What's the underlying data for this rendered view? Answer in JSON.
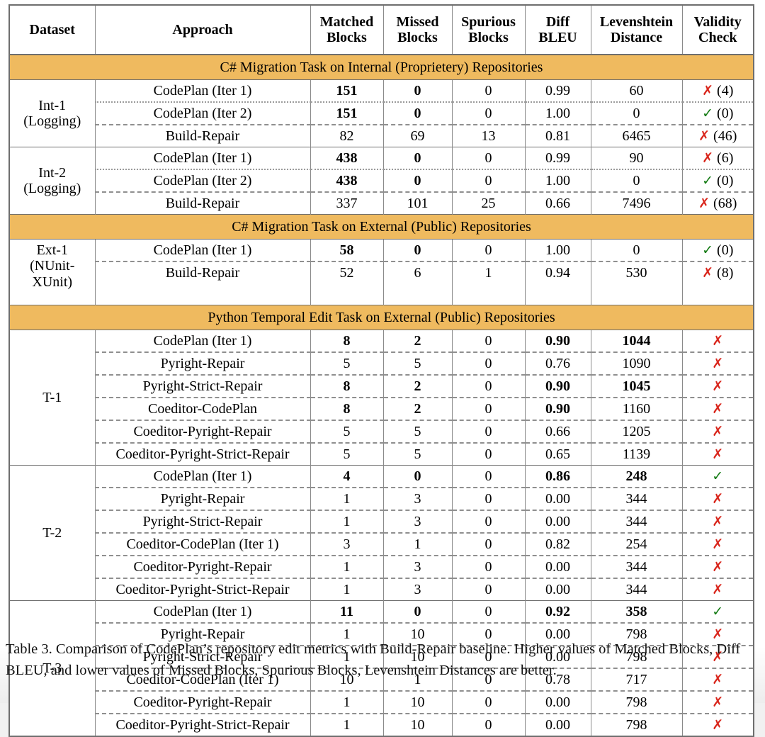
{
  "table": {
    "columns": [
      {
        "id": "dataset",
        "line1": "Dataset",
        "line2": ""
      },
      {
        "id": "approach",
        "line1": "Approach",
        "line2": ""
      },
      {
        "id": "matched",
        "line1": "Matched",
        "line2": "Blocks"
      },
      {
        "id": "missed",
        "line1": "Missed",
        "line2": "Blocks"
      },
      {
        "id": "spurious",
        "line1": "Spurious",
        "line2": "Blocks"
      },
      {
        "id": "bleu",
        "line1": "Diff",
        "line2": "BLEU"
      },
      {
        "id": "lev",
        "line1": "Levenshtein",
        "line2": "Distance"
      },
      {
        "id": "valid",
        "line1": "Validity",
        "line2": "Check"
      }
    ],
    "sections": [
      {
        "id": "section-csharp-internal",
        "banner": "C# Migration Task on Internal (Proprietery) Repositories",
        "groups": [
          {
            "dataset_l1": "Int-1",
            "dataset_l2": "(Logging)",
            "rows": [
              {
                "approach": "CodePlan (Iter 1)",
                "matched": "151",
                "matched_b": true,
                "missed": "0",
                "missed_b": true,
                "spurious": "0",
                "bleu": "0.99",
                "lev": "60",
                "valid_mark": "x",
                "valid_count": "(4)",
                "sep": "group-top"
              },
              {
                "approach": "CodePlan (Iter 2)",
                "matched": "151",
                "matched_b": true,
                "missed": "0",
                "missed_b": true,
                "spurious": "0",
                "bleu": "1.00",
                "lev": "0",
                "valid_mark": "v",
                "valid_count": "(0)",
                "sep": "dotted"
              },
              {
                "approach": "Build-Repair",
                "matched": "82",
                "matched_b": false,
                "missed": "69",
                "missed_b": false,
                "spurious": "13",
                "bleu": "0.81",
                "lev": "6465",
                "valid_mark": "x",
                "valid_count": "(46)",
                "sep": "dashed"
              }
            ]
          },
          {
            "dataset_l1": "Int-2",
            "dataset_l2": "(Logging)",
            "rows": [
              {
                "approach": "CodePlan (Iter 1)",
                "matched": "438",
                "matched_b": true,
                "missed": "0",
                "missed_b": true,
                "spurious": "0",
                "bleu": "0.99",
                "lev": "90",
                "valid_mark": "x",
                "valid_count": "(6)",
                "sep": "group-top"
              },
              {
                "approach": "CodePlan (Iter 2)",
                "matched": "438",
                "matched_b": true,
                "missed": "0",
                "missed_b": true,
                "spurious": "0",
                "bleu": "1.00",
                "lev": "0",
                "valid_mark": "v",
                "valid_count": "(0)",
                "sep": "dotted"
              },
              {
                "approach": "Build-Repair",
                "matched": "337",
                "matched_b": false,
                "missed": "101",
                "missed_b": false,
                "spurious": "25",
                "bleu": "0.66",
                "lev": "7496",
                "valid_mark": "x",
                "valid_count": "(68)",
                "sep": "dashed"
              }
            ]
          }
        ]
      },
      {
        "id": "section-csharp-external",
        "banner": "C# Migration Task on External (Public) Repositories",
        "groups": [
          {
            "dataset_l1": "Ext-1",
            "dataset_l2": "(NUnit-",
            "dataset_l3": "XUnit)",
            "rows": [
              {
                "approach": "CodePlan (Iter 1)",
                "matched": "58",
                "matched_b": true,
                "missed": "0",
                "missed_b": true,
                "spurious": "0",
                "bleu": "1.00",
                "lev": "0",
                "valid_mark": "v",
                "valid_count": "(0)",
                "sep": "group-top"
              },
              {
                "approach": "Build-Repair",
                "matched": "52",
                "matched_b": false,
                "missed": "6",
                "missed_b": false,
                "spurious": "1",
                "bleu": "0.94",
                "lev": "530",
                "valid_mark": "x",
                "valid_count": "(8)",
                "sep": "dashed"
              },
              {
                "approach": "",
                "matched": "",
                "missed": "",
                "spurious": "",
                "bleu": "",
                "lev": "",
                "valid_mark": "",
                "valid_count": "",
                "sep": "none",
                "filler": true
              }
            ]
          }
        ]
      },
      {
        "id": "section-python-temporal",
        "banner": "Python Temporal Edit Task on External (Public) Repositories",
        "groups": [
          {
            "dataset_l1": "T-1",
            "dataset_l2": "",
            "rows": [
              {
                "approach": "CodePlan (Iter 1)",
                "matched": "8",
                "matched_b": true,
                "missed": "2",
                "missed_b": true,
                "spurious": "0",
                "bleu": "0.90",
                "bleu_b": true,
                "lev": "1044",
                "lev_b": true,
                "valid_mark": "x",
                "valid_count": "",
                "sep": "group-top"
              },
              {
                "approach": "Pyright-Repair",
                "matched": "5",
                "matched_b": false,
                "missed": "5",
                "missed_b": false,
                "spurious": "0",
                "bleu": "0.76",
                "bleu_b": false,
                "lev": "1090",
                "lev_b": false,
                "valid_mark": "x",
                "valid_count": "",
                "sep": "dashed"
              },
              {
                "approach": "Pyright-Strict-Repair",
                "matched": "8",
                "matched_b": true,
                "missed": "2",
                "missed_b": true,
                "spurious": "0",
                "bleu": "0.90",
                "bleu_b": true,
                "lev": "1045",
                "lev_b": true,
                "valid_mark": "x",
                "valid_count": "",
                "sep": "dashed"
              },
              {
                "approach": "Coeditor-CodePlan",
                "matched": "8",
                "matched_b": true,
                "missed": "2",
                "missed_b": true,
                "spurious": "0",
                "bleu": "0.90",
                "bleu_b": true,
                "lev": "1160",
                "lev_b": false,
                "valid_mark": "x",
                "valid_count": "",
                "sep": "dashed"
              },
              {
                "approach": "Coeditor-Pyright-Repair",
                "matched": "5",
                "matched_b": false,
                "missed": "5",
                "missed_b": false,
                "spurious": "0",
                "bleu": "0.66",
                "bleu_b": false,
                "lev": "1205",
                "lev_b": false,
                "valid_mark": "x",
                "valid_count": "",
                "sep": "dashed"
              },
              {
                "approach": "Coeditor-Pyright-Strict-Repair",
                "matched": "5",
                "matched_b": false,
                "missed": "5",
                "missed_b": false,
                "spurious": "0",
                "bleu": "0.65",
                "bleu_b": false,
                "lev": "1139",
                "lev_b": false,
                "valid_mark": "x",
                "valid_count": "",
                "sep": "dashed"
              }
            ]
          },
          {
            "dataset_l1": "T-2",
            "dataset_l2": "",
            "rows": [
              {
                "approach": "CodePlan (Iter 1)",
                "matched": "4",
                "matched_b": true,
                "missed": "0",
                "missed_b": true,
                "spurious": "0",
                "bleu": "0.86",
                "bleu_b": true,
                "lev": "248",
                "lev_b": true,
                "valid_mark": "v",
                "valid_count": "",
                "sep": "group-top"
              },
              {
                "approach": "Pyright-Repair",
                "matched": "1",
                "matched_b": false,
                "missed": "3",
                "missed_b": false,
                "spurious": "0",
                "bleu": "0.00",
                "bleu_b": false,
                "lev": "344",
                "lev_b": false,
                "valid_mark": "x",
                "valid_count": "",
                "sep": "dashed"
              },
              {
                "approach": "Pyright-Strict-Repair",
                "matched": "1",
                "matched_b": false,
                "missed": "3",
                "missed_b": false,
                "spurious": "0",
                "bleu": "0.00",
                "bleu_b": false,
                "lev": "344",
                "lev_b": false,
                "valid_mark": "x",
                "valid_count": "",
                "sep": "dashed"
              },
              {
                "approach": "Coeditor-CodePlan (Iter 1)",
                "matched": "3",
                "matched_b": false,
                "missed": "1",
                "missed_b": false,
                "spurious": "0",
                "bleu": "0.82",
                "bleu_b": false,
                "lev": "254",
                "lev_b": false,
                "valid_mark": "x",
                "valid_count": "",
                "sep": "dashed"
              },
              {
                "approach": "Coeditor-Pyright-Repair",
                "matched": "1",
                "matched_b": false,
                "missed": "3",
                "missed_b": false,
                "spurious": "0",
                "bleu": "0.00",
                "bleu_b": false,
                "lev": "344",
                "lev_b": false,
                "valid_mark": "x",
                "valid_count": "",
                "sep": "dashed"
              },
              {
                "approach": "Coeditor-Pyright-Strict-Repair",
                "matched": "1",
                "matched_b": false,
                "missed": "3",
                "missed_b": false,
                "spurious": "0",
                "bleu": "0.00",
                "bleu_b": false,
                "lev": "344",
                "lev_b": false,
                "valid_mark": "x",
                "valid_count": "",
                "sep": "dashed"
              }
            ]
          },
          {
            "dataset_l1": "T-3",
            "dataset_l2": "",
            "rows": [
              {
                "approach": "CodePlan (Iter 1)",
                "matched": "11",
                "matched_b": true,
                "missed": "0",
                "missed_b": true,
                "spurious": "0",
                "bleu": "0.92",
                "bleu_b": true,
                "lev": "358",
                "lev_b": true,
                "valid_mark": "v",
                "valid_count": "",
                "sep": "group-top"
              },
              {
                "approach": "Pyright-Repair",
                "matched": "1",
                "matched_b": false,
                "missed": "10",
                "missed_b": false,
                "spurious": "0",
                "bleu": "0.00",
                "bleu_b": false,
                "lev": "798",
                "lev_b": false,
                "valid_mark": "x",
                "valid_count": "",
                "sep": "dashed"
              },
              {
                "approach": "Pyright-Strict-Repair",
                "matched": "1",
                "matched_b": false,
                "missed": "10",
                "missed_b": false,
                "spurious": "0",
                "bleu": "0.00",
                "bleu_b": false,
                "lev": "798",
                "lev_b": false,
                "valid_mark": "x",
                "valid_count": "",
                "sep": "dashed"
              },
              {
                "approach": "Coeditor-CodePlan (Iter 1)",
                "matched": "10",
                "matched_b": false,
                "missed": "1",
                "missed_b": false,
                "spurious": "0",
                "bleu": "0.78",
                "bleu_b": false,
                "lev": "717",
                "lev_b": false,
                "valid_mark": "x",
                "valid_count": "",
                "sep": "dashed"
              },
              {
                "approach": "Coeditor-Pyright-Repair",
                "matched": "1",
                "matched_b": false,
                "missed": "10",
                "missed_b": false,
                "spurious": "0",
                "bleu": "0.00",
                "bleu_b": false,
                "lev": "798",
                "lev_b": false,
                "valid_mark": "x",
                "valid_count": "",
                "sep": "dashed"
              },
              {
                "approach": "Coeditor-Pyright-Strict-Repair",
                "matched": "1",
                "matched_b": false,
                "missed": "10",
                "missed_b": false,
                "spurious": "0",
                "bleu": "0.00",
                "bleu_b": false,
                "lev": "798",
                "lev_b": false,
                "valid_mark": "x",
                "valid_count": "",
                "sep": "dashed"
              }
            ]
          }
        ]
      }
    ]
  },
  "caption": "Table 3. Comparison of CodePlan’s repository edit metrics with Build-Repair baseline. Higher values of Matched Blocks, Diff BLEU, and lower values of Missed Blocks, Spurious Blocks, Levenshtein Distances are better.",
  "icons": {
    "valid_pass": "✓",
    "valid_fail": "✗"
  },
  "colors": {
    "section_banner": "#efba5f",
    "fail_mark": "#d9261c",
    "pass_mark": "#127a12",
    "table_border": "#6e6e6e"
  }
}
